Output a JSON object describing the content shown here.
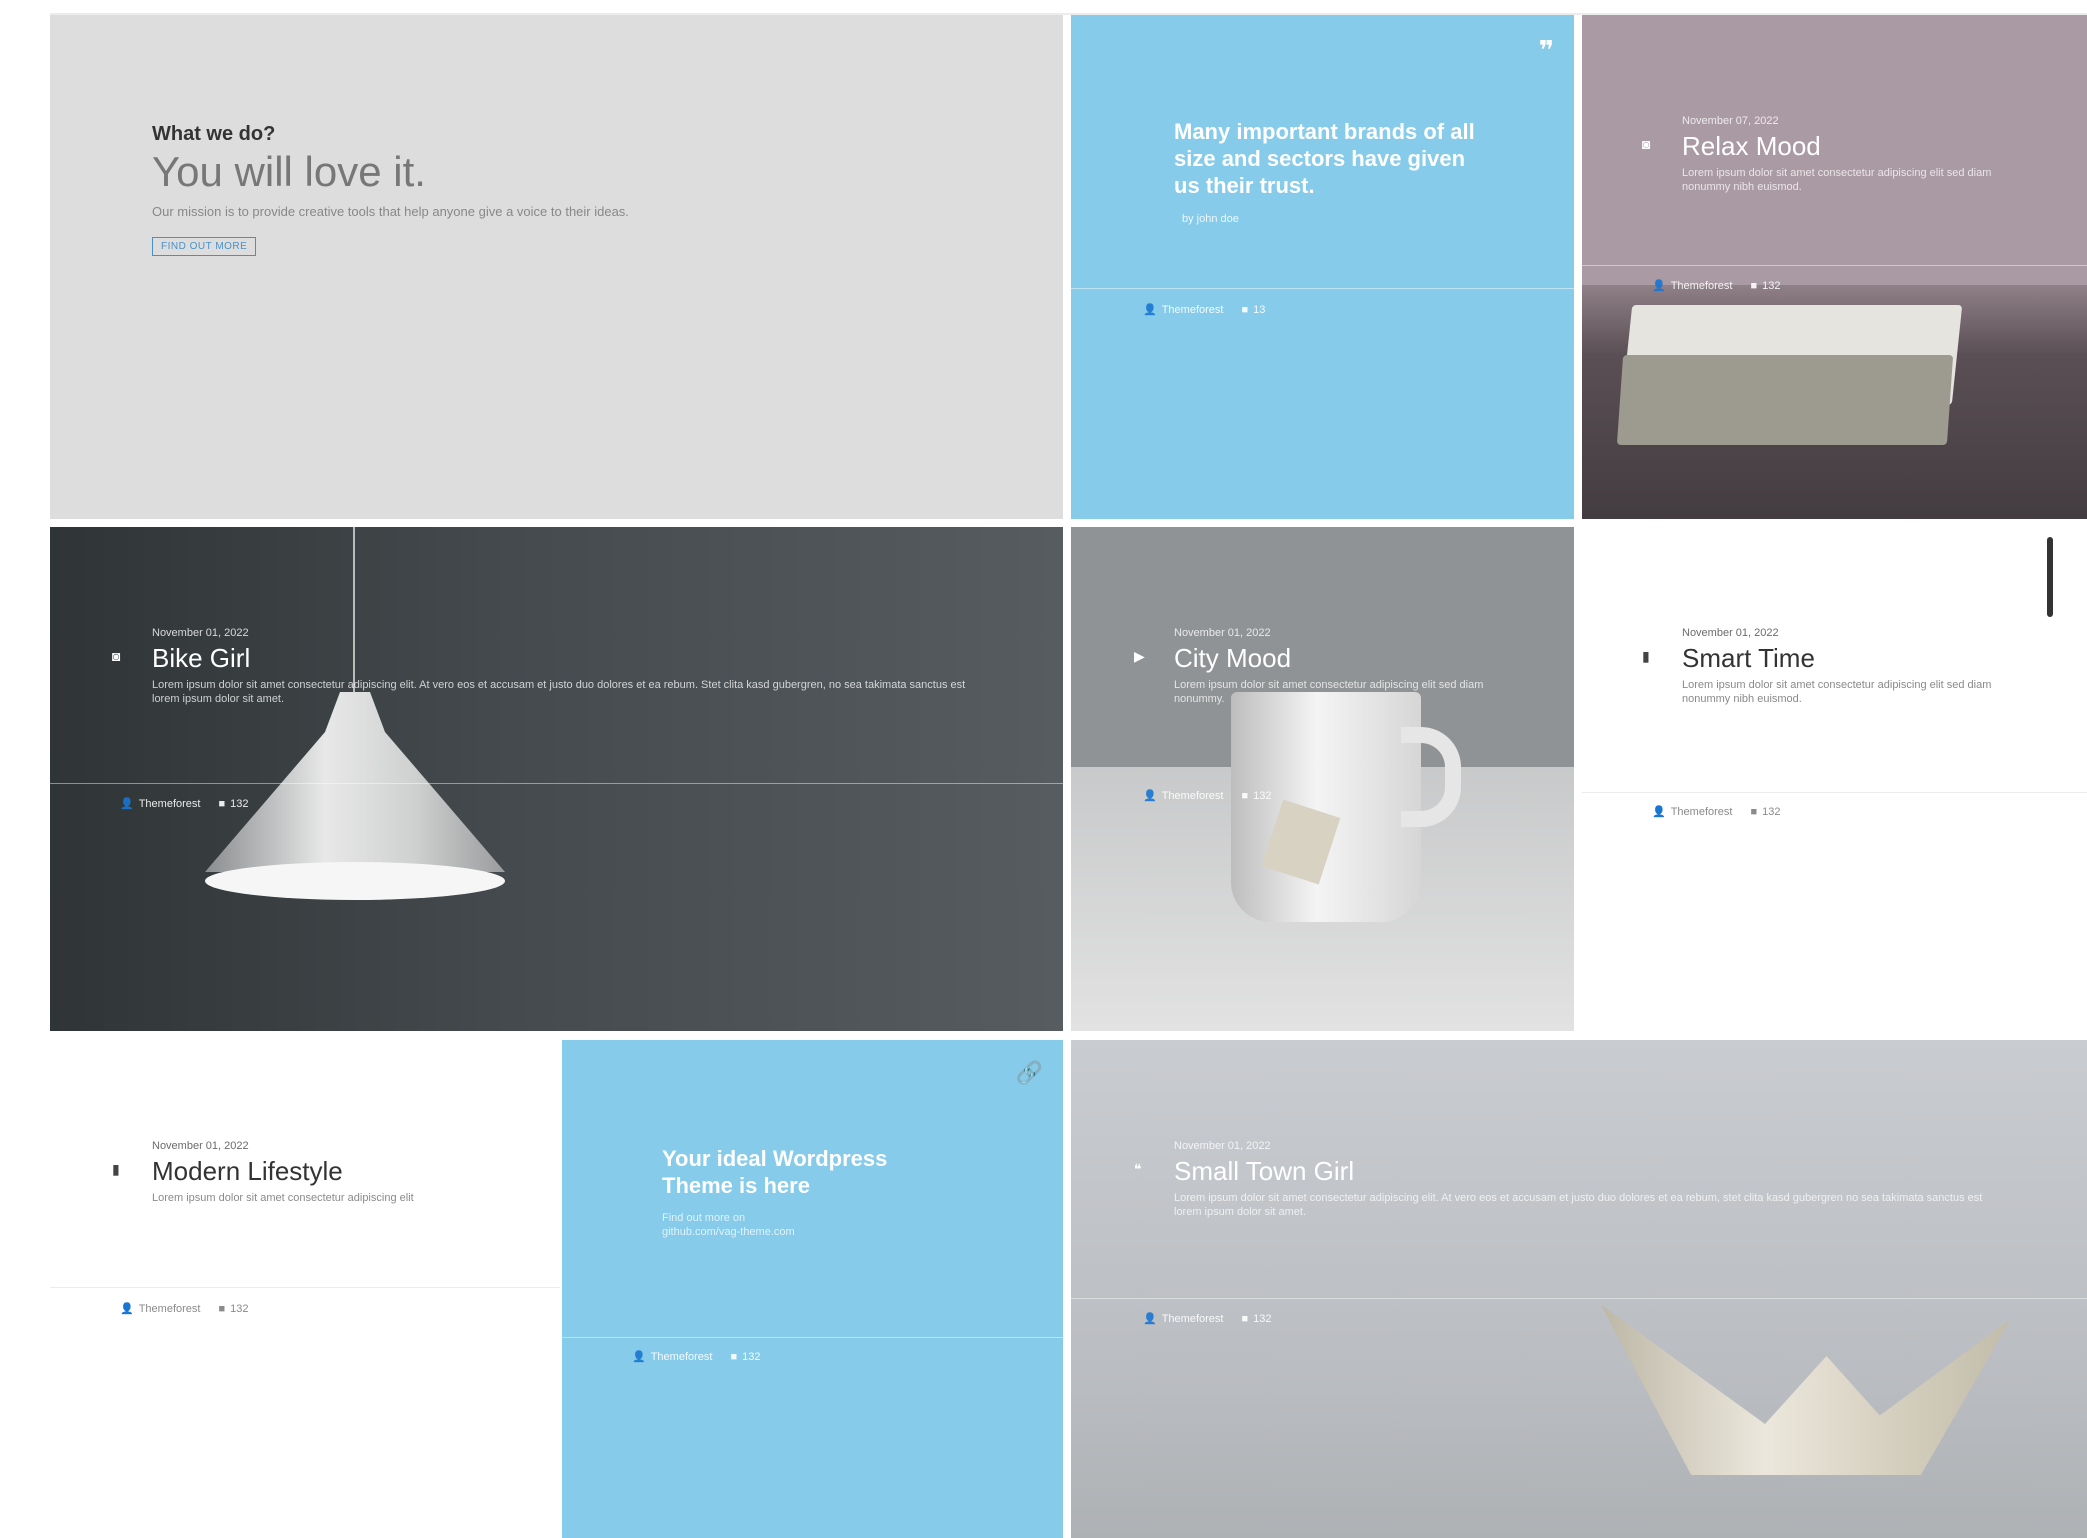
{
  "hero": {
    "subtitle": "What we do?",
    "title": "You will love it.",
    "description": "Our mission is to provide creative tools that help anyone give a voice to their ideas.",
    "button": "FIND OUT MORE"
  },
  "quote": {
    "text": "Many important brands of all size and sectors have given us their trust.",
    "author": "by john doe",
    "meta": {
      "author": "Themeforest",
      "comments": "13"
    }
  },
  "relax": {
    "date": "November 07, 2022",
    "title": "Relax Mood",
    "text": "Lorem ipsum dolor sit amet consectetur adipiscing elit sed diam nonummy nibh euismod.",
    "meta": {
      "author": "Themeforest",
      "comments": "132"
    }
  },
  "bike": {
    "date": "November 01, 2022",
    "title": "Bike Girl",
    "text": "Lorem ipsum dolor sit amet consectetur adipiscing elit. At vero eos et accusam et justo duo dolores et ea rebum. Stet clita kasd gubergren, no sea takimata sanctus est lorem ipsum dolor sit amet.",
    "meta": {
      "author": "Themeforest",
      "comments": "132"
    }
  },
  "city": {
    "date": "November 01, 2022",
    "title": "City Mood",
    "text": "Lorem ipsum dolor sit amet consectetur adipiscing elit sed diam nonummy.",
    "meta": {
      "author": "Themeforest",
      "comments": "132"
    }
  },
  "smart": {
    "date": "November 01, 2022",
    "title": "Smart Time",
    "text": "Lorem ipsum dolor sit amet consectetur adipiscing elit sed diam nonummy nibh euismod.",
    "meta": {
      "author": "Themeforest",
      "comments": "132"
    }
  },
  "modern": {
    "date": "November 01, 2022",
    "title": "Modern Lifestyle",
    "text": "Lorem ipsum dolor sit amet consectetur adipiscing elit",
    "meta": {
      "author": "Themeforest",
      "comments": "132"
    }
  },
  "ideal": {
    "title": "Your ideal Wordpress Theme is here",
    "text": "Find out more on github.com/vag-theme.com",
    "meta": {
      "author": "Themeforest",
      "comments": "132"
    }
  },
  "town": {
    "date": "November 01, 2022",
    "title": "Small Town Girl",
    "text": "Lorem ipsum dolor sit amet consectetur adipiscing elit. At vero eos et accusam et justo duo dolores et ea rebum, stet clita kasd gubergren no sea takimata sanctus est lorem ipsum dolor sit amet.",
    "meta": {
      "author": "Themeforest",
      "comments": "132"
    }
  },
  "colors": {
    "accent": "#86cbea",
    "link": "#4a90c8"
  }
}
